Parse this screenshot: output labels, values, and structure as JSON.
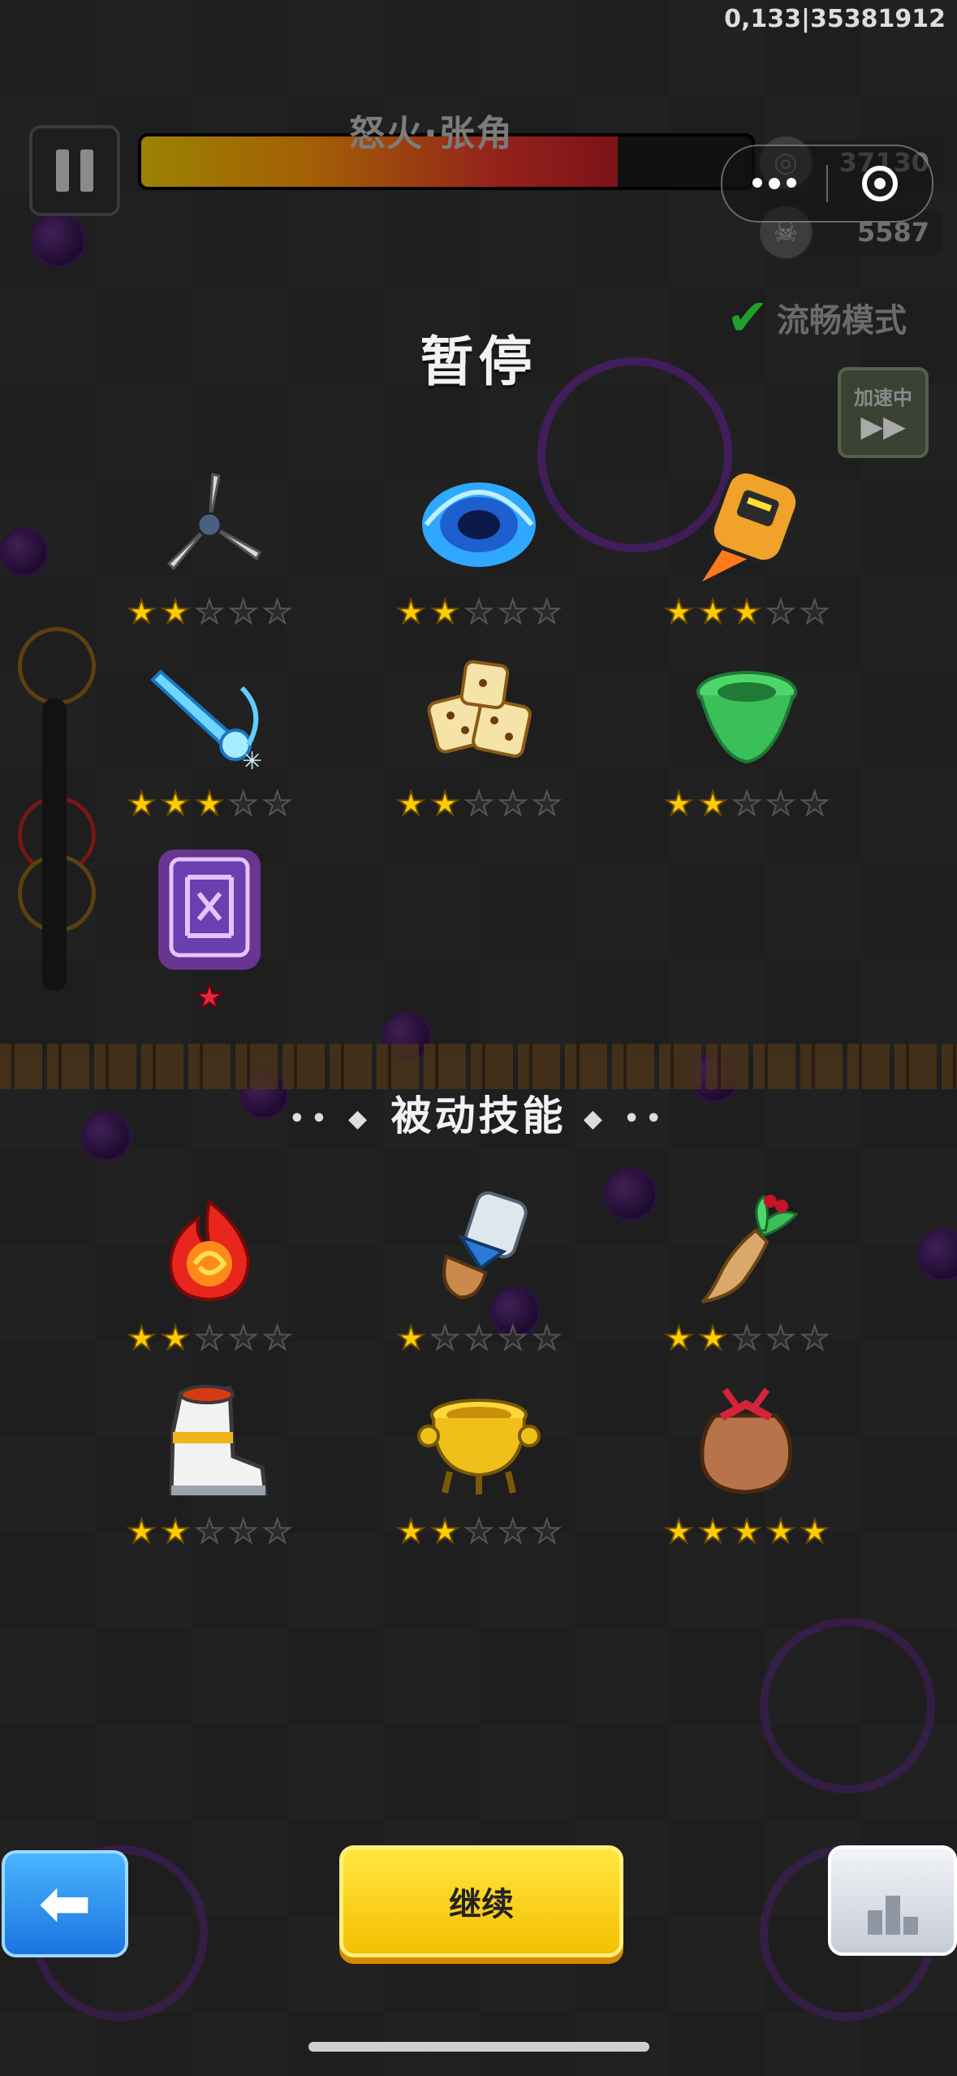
{
  "status_id": "0,133|35381912",
  "boss": {
    "name": "怒火·张角",
    "health_fraction": 0.78
  },
  "stats": {
    "coins": "37130",
    "kills": "5587"
  },
  "smooth_mode": "流畅模式",
  "speed": {
    "label": "加速中",
    "icon": "fast-forward-icon"
  },
  "pause_title": "暂停",
  "active_skills": [
    {
      "icon": "shuriken-blade-icon",
      "stars": 2,
      "max": 5
    },
    {
      "icon": "vortex-icon",
      "stars": 2,
      "max": 5
    },
    {
      "icon": "rocket-robot-icon",
      "stars": 3,
      "max": 5
    },
    {
      "icon": "ice-sword-icon",
      "stars": 3,
      "max": 5
    },
    {
      "icon": "dice-icon",
      "stars": 2,
      "max": 5
    },
    {
      "icon": "green-tornado-icon",
      "stars": 2,
      "max": 5
    },
    {
      "icon": "purple-scroll-icon",
      "stars": 1,
      "max": 1,
      "red": true
    }
  ],
  "passive_title": "被动技能",
  "passive_skills": [
    {
      "icon": "fire-orb-icon",
      "stars": 2,
      "max": 5
    },
    {
      "icon": "gauntlet-icon",
      "stars": 1,
      "max": 5
    },
    {
      "icon": "ginseng-icon",
      "stars": 2,
      "max": 5
    },
    {
      "icon": "boot-icon",
      "stars": 2,
      "max": 5
    },
    {
      "icon": "golden-cauldron-icon",
      "stars": 2,
      "max": 5
    },
    {
      "icon": "pouch-icon",
      "stars": 5,
      "max": 5
    }
  ],
  "buttons": {
    "continue": "继续",
    "back_icon": "back-arrow-icon",
    "rank_icon": "podium-icon"
  },
  "colors": {
    "star_on": "#ffcc00",
    "continue": "#ffd400",
    "back": "#1b74e0"
  }
}
